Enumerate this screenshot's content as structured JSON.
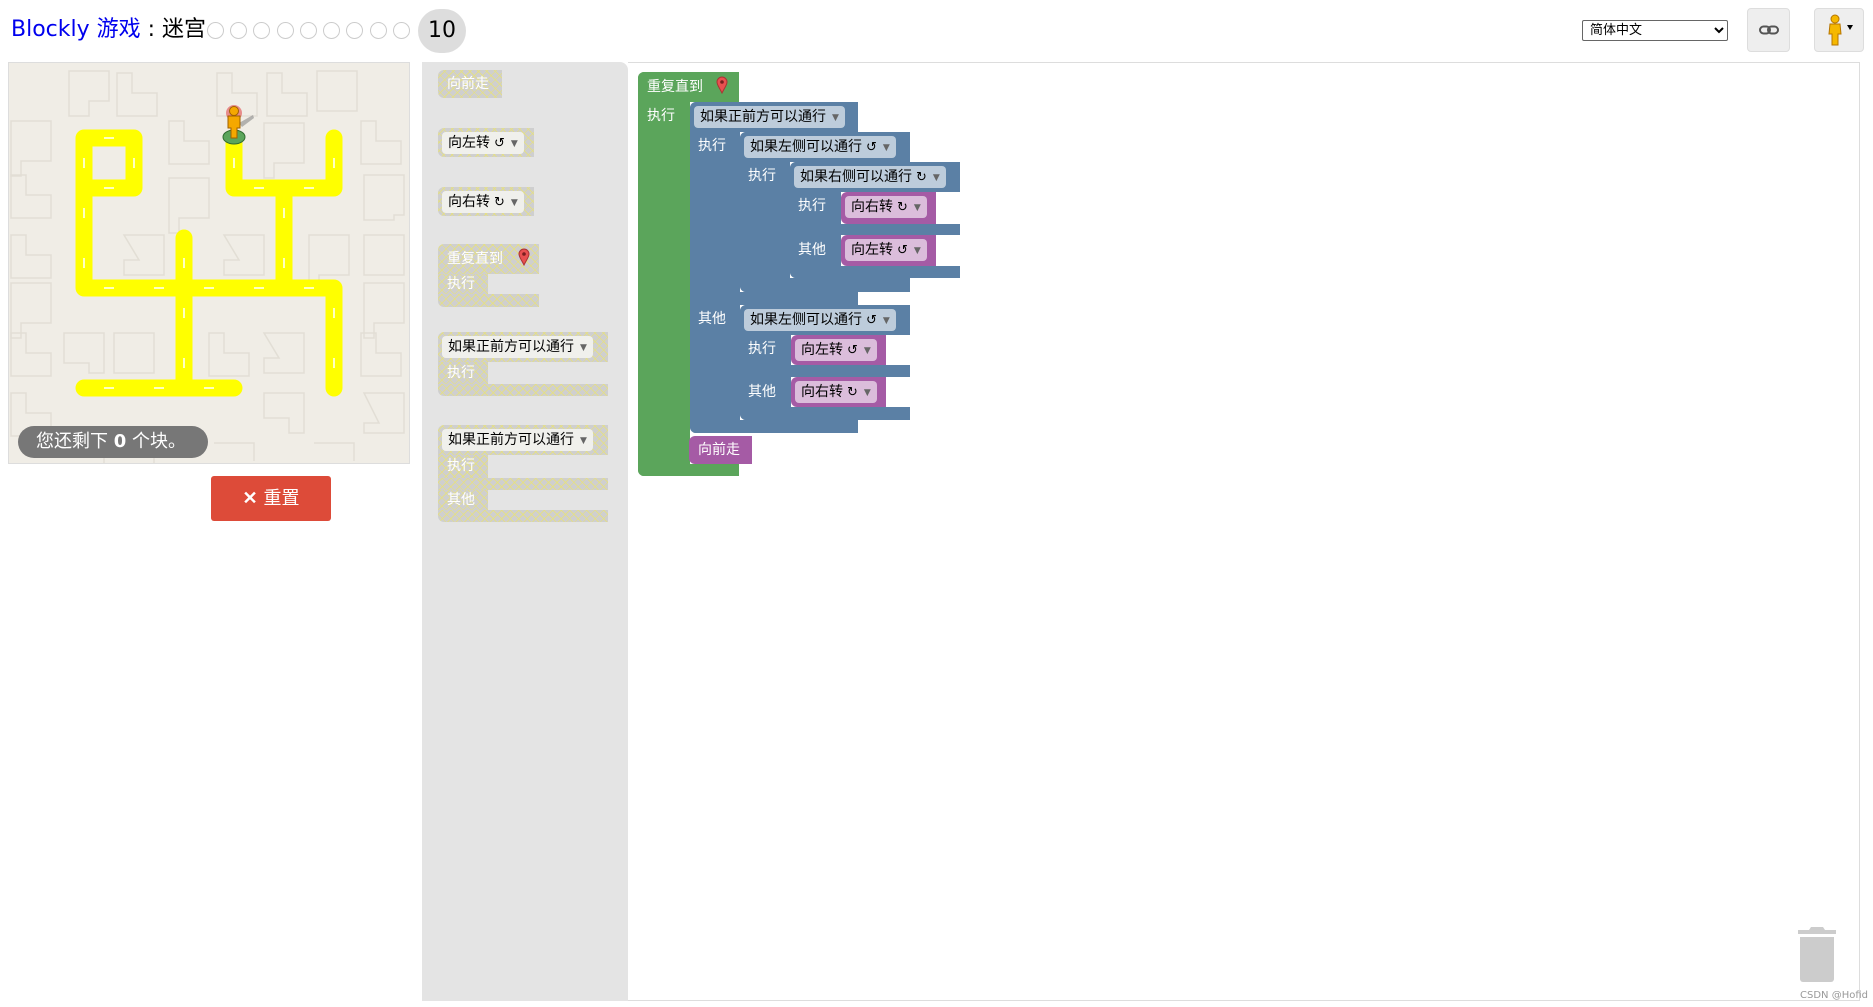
{
  "header": {
    "brand": "Blockly 游戏",
    "separator": " : ",
    "game": "迷宫",
    "levels": [
      1,
      2,
      3,
      4,
      5,
      6,
      7,
      8,
      9
    ],
    "current_level": "10",
    "language": "简体中文",
    "link_icon": "link-icon",
    "avatar_icon": "pegman-icon"
  },
  "maze": {
    "remaining_prefix": "您还剩下 ",
    "remaining_count": "0",
    "remaining_suffix": " 个块。",
    "reset_label": "重置"
  },
  "toolbox": {
    "forward": "向前走",
    "turn_left": "向左转",
    "turn_right": "向右转",
    "repeat_until": "重复直到",
    "do": "执行",
    "else": "其他",
    "if_path_ahead": "如果正前方可以通行"
  },
  "workspace": {
    "repeat_until": "重复直到",
    "do": "执行",
    "else": "其他",
    "if_ahead": "如果正前方可以通行",
    "if_left": "如果左侧可以通行",
    "if_right": "如果右侧可以通行",
    "turn_left": "向左转",
    "turn_right": "向右转",
    "forward": "向前走"
  },
  "watermark": "CSDN @Hofid",
  "colors": {
    "loop": "#5ba55b",
    "logic": "#5b80a5",
    "movement": "#a55ba5",
    "path": "#ffff00",
    "reset": "#dd4b39"
  }
}
